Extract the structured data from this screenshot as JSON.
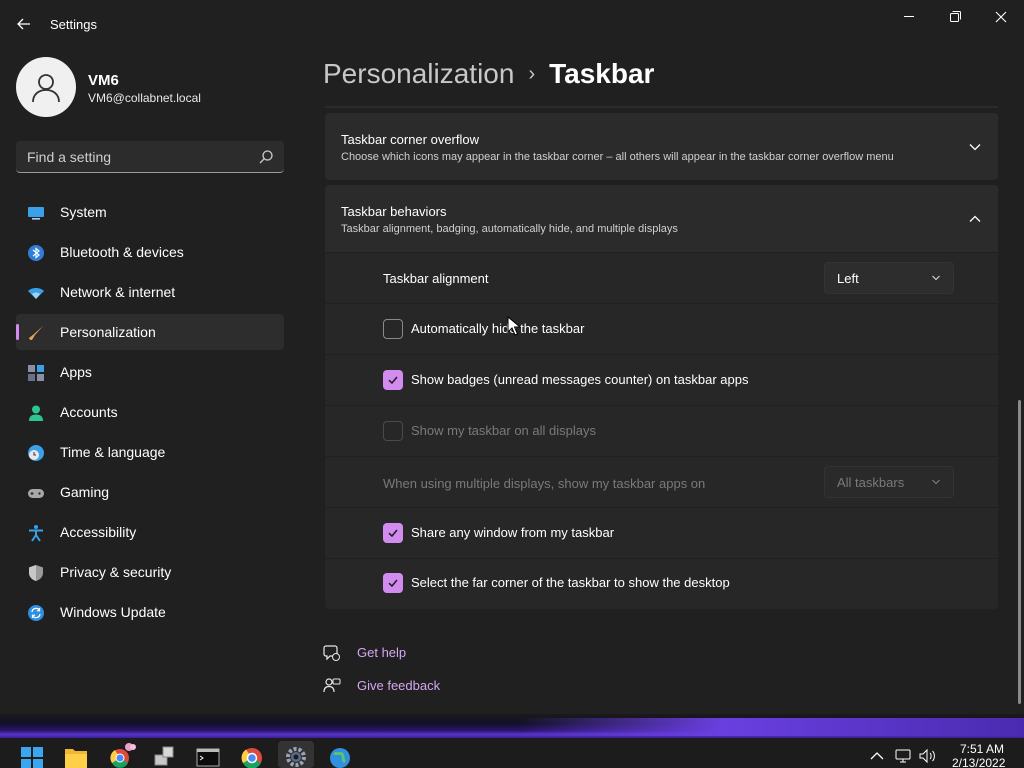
{
  "window": {
    "app_title": "Settings"
  },
  "profile": {
    "name": "VM6",
    "email": "VM6@collabnet.local"
  },
  "search": {
    "placeholder": "Find a setting"
  },
  "sidebar": {
    "items": [
      {
        "label": "System",
        "icon": "system-icon"
      },
      {
        "label": "Bluetooth & devices",
        "icon": "bluetooth-icon"
      },
      {
        "label": "Network & internet",
        "icon": "wifi-icon"
      },
      {
        "label": "Personalization",
        "icon": "brush-icon",
        "active": true
      },
      {
        "label": "Apps",
        "icon": "apps-icon"
      },
      {
        "label": "Accounts",
        "icon": "accounts-icon"
      },
      {
        "label": "Time & language",
        "icon": "clock-globe-icon"
      },
      {
        "label": "Gaming",
        "icon": "gamepad-icon"
      },
      {
        "label": "Accessibility",
        "icon": "accessibility-icon"
      },
      {
        "label": "Privacy & security",
        "icon": "shield-icon"
      },
      {
        "label": "Windows Update",
        "icon": "update-icon"
      }
    ]
  },
  "breadcrumb": {
    "parent": "Personalization",
    "separator": "›",
    "current": "Taskbar"
  },
  "sections": {
    "corner_overflow": {
      "title": "Taskbar corner overflow",
      "description": "Choose which icons may appear in the taskbar corner – all others will appear in the taskbar corner overflow menu",
      "expanded": false
    },
    "behaviors": {
      "title": "Taskbar behaviors",
      "description": "Taskbar alignment, badging, automatically hide, and multiple displays",
      "expanded": true
    }
  },
  "settings": {
    "alignment_label": "Taskbar alignment",
    "alignment_value": "Left",
    "autohide_label": "Automatically hide the taskbar",
    "autohide_checked": false,
    "badges_label": "Show badges (unread messages counter) on taskbar apps",
    "badges_checked": true,
    "all_displays_label": "Show my taskbar on all displays",
    "all_displays_checked": false,
    "multi_display_label": "When using multiple displays, show my taskbar apps on",
    "multi_display_value": "All taskbars",
    "share_window_label": "Share any window from my taskbar",
    "share_window_checked": true,
    "far_corner_label": "Select the far corner of the taskbar to show the desktop",
    "far_corner_checked": true
  },
  "help_links": {
    "get_help": "Get help",
    "give_feedback": "Give feedback"
  },
  "taskbar": {
    "apps": [
      "start-icon",
      "file-explorer-icon",
      "chrome-profile-icon",
      "network-app-icon",
      "terminal-icon",
      "chrome-icon",
      "settings-icon",
      "globe-app-icon"
    ],
    "clock_time": "7:51 AM",
    "clock_date": "2/13/2022"
  },
  "colors": {
    "accent": "#d28cf0",
    "background": "#202020",
    "card": "#2b2b2b",
    "link": "#d6a6f0"
  }
}
